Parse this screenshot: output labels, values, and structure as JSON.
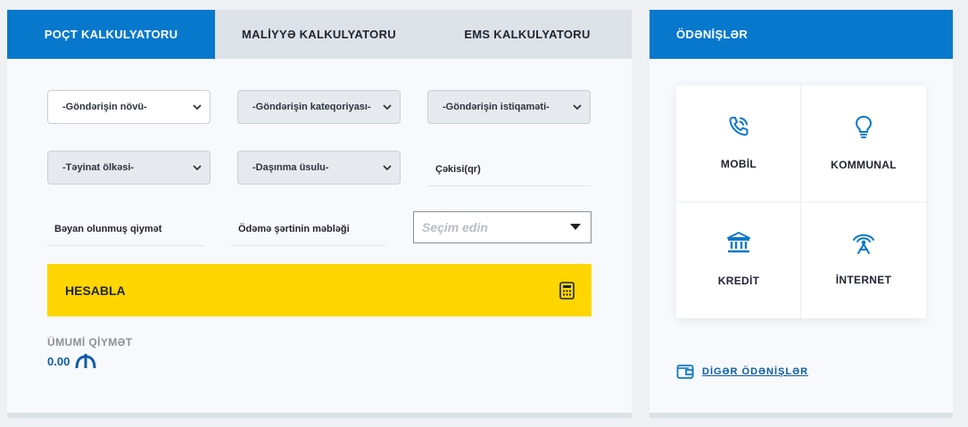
{
  "tabs": [
    {
      "label": "POÇT KALKULYATORU"
    },
    {
      "label": "MALİYYƏ KALKULYATORU"
    },
    {
      "label": "EMS KALKULYATORU"
    }
  ],
  "form": {
    "shipment_type": "-Göndərişin növü-",
    "shipment_category": "-Göndərişin kateqoriyası-",
    "shipment_direction": "-Göndərişin istiqaməti-",
    "destination_country": "-Təyinat ölkəsi-",
    "transport_method": "-Daşınma üsulu-",
    "weight_label": "Çəkisi(qr)",
    "declared_value_label": "Bəyan olunmuş qiymət",
    "payment_amount_label": "Ödəmə şərtinin məbləği",
    "choice_placeholder": "Seçim edin"
  },
  "calculate_label": "HESABLA",
  "total": {
    "label": "ÜMUMİ QİYMƏT",
    "value": "0.00"
  },
  "payments": {
    "title": "ÖDƏNİŞLƏR",
    "items": [
      {
        "label": "MOBİL",
        "icon": "phone-icon"
      },
      {
        "label": "KOMMUNAL",
        "icon": "lightbulb-icon"
      },
      {
        "label": "KREDİT",
        "icon": "bank-icon"
      },
      {
        "label": "İNTERNET",
        "icon": "antenna-icon"
      }
    ],
    "other_label": "DİGƏR ÖDƏNİŞLƏR"
  },
  "colors": {
    "brand_blue": "#0778cc",
    "accent_yellow": "#ffd600",
    "link_blue": "#0b5ca8"
  }
}
